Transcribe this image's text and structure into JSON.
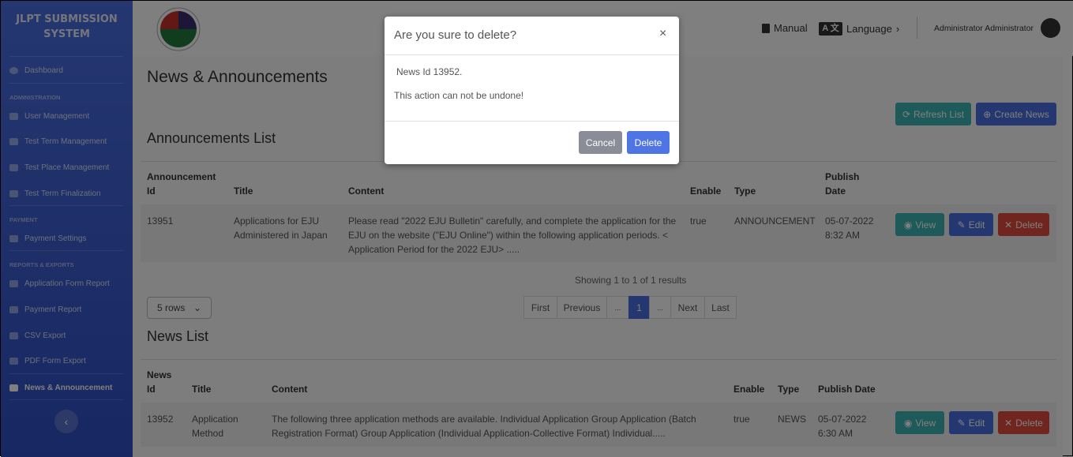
{
  "sidebar": {
    "brand": "JLPT SUBMISSION SYSTEM",
    "items": [
      {
        "label": "Dashboard",
        "icon": "dashboard-icon"
      },
      {
        "section": "ADMINISTRATION"
      },
      {
        "label": "User Management",
        "icon": "user-gear-icon"
      },
      {
        "label": "Test Term Management",
        "icon": "paper-plane-icon"
      },
      {
        "label": "Test Place Management",
        "icon": "building-icon"
      },
      {
        "label": "Test Term Finalization",
        "icon": "card-icon"
      },
      {
        "section": "PAYMENT"
      },
      {
        "label": "Payment Settings",
        "icon": "credit-card-icon"
      },
      {
        "section": "REPORTS & EXPORTS"
      },
      {
        "label": "Application Form Report",
        "icon": "file-icon"
      },
      {
        "label": "Payment Report",
        "icon": "file-invoice-icon"
      },
      {
        "label": "CSV Export",
        "icon": "file-csv-icon"
      },
      {
        "label": "PDF Form Export",
        "icon": "file-pdf-icon"
      },
      {
        "label": "News & Announcement",
        "icon": "newspaper-icon",
        "active": true
      }
    ]
  },
  "header": {
    "manual": "Manual",
    "language": "Language",
    "user": "Administrator Administrator"
  },
  "page": {
    "title": "News & Announcements",
    "refresh": "Refresh List",
    "create": "Create News"
  },
  "announcements": {
    "title": "Announcements List",
    "headers": [
      "Announcement Id",
      "Title",
      "Content",
      "Enable",
      "Type",
      "Publish Date"
    ],
    "rows": [
      {
        "id": "13951",
        "title": "Applications for EJU Administered in Japan",
        "content": "Please read \"2022 EJU Bulletin\" carefully, and complete the application for the EJU on the website (\"EJU Online\") within the following application periods. < Application Period for the 2022 EJU> .....",
        "enable": "true",
        "type": "ANNOUNCEMENT",
        "date": "05-07-2022 8:32 AM"
      }
    ],
    "showing": "Showing 1 to 1 of 1 results",
    "rows_select": "5 rows",
    "pagination": [
      "First",
      "Previous",
      "...",
      "1",
      "...",
      "Next",
      "Last"
    ]
  },
  "news": {
    "title": "News List",
    "headers": [
      "News Id",
      "Title",
      "Content",
      "Enable",
      "Type",
      "Publish Date"
    ],
    "rows": [
      {
        "id": "13952",
        "title": "Application Method",
        "content": "The following three application methods are available. Individual Application Group Application (Batch Registration Format) Group Application (Individual Application-Collective Format) Individual.....",
        "enable": "true",
        "type": "NEWS",
        "date": "05-07-2022 6:30 AM"
      }
    ]
  },
  "actions": {
    "view": "View",
    "edit": "Edit",
    "delete": "Delete"
  },
  "modal": {
    "title": "Are you sure to delete?",
    "close": "×",
    "line1": "News Id 13952.",
    "line2": "This action can not be undone!",
    "cancel": "Cancel",
    "confirm": "Delete"
  }
}
